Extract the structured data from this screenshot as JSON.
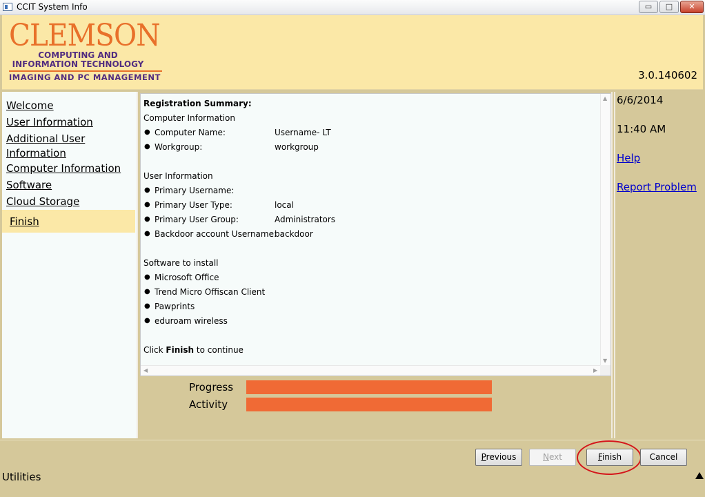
{
  "window": {
    "title": "CCIT System Info",
    "icon": "app-window-icon",
    "controls": {
      "minimize": "▭",
      "maximize": "□",
      "close": "✕"
    }
  },
  "header": {
    "logo": {
      "brand": "CLEMSON",
      "line1": "COMPUTING AND",
      "line2": "INFORMATION TECHNOLOGY",
      "line3": "IMAGING AND PC MANAGEMENT"
    },
    "version": "3.0.140602"
  },
  "nav": {
    "items": [
      {
        "label": "Welcome"
      },
      {
        "label": "User Information"
      },
      {
        "label": "Additional User"
      },
      {
        "label": "Information"
      },
      {
        "label": "Computer Information"
      },
      {
        "label": "Software"
      },
      {
        "label": "Cloud Storage"
      },
      {
        "label": "Finish",
        "selected": true
      }
    ]
  },
  "summary": {
    "heading": "Registration Summary:",
    "computer_section": "Computer Information",
    "computer_rows": [
      {
        "key": "Computer Name:",
        "value": "Username-  LT"
      },
      {
        "key": "Workgroup:",
        "value": "workgroup"
      }
    ],
    "user_section": "User Information",
    "user_rows": [
      {
        "key": "Primary Username:",
        "value": ""
      },
      {
        "key": "Primary User Type:",
        "value": "local"
      },
      {
        "key": "Primary User Group:",
        "value": "Administrators"
      },
      {
        "key": "Backdoor account Username:",
        "value": "backdoor"
      }
    ],
    "software_section": "Software to install",
    "software_items": [
      "Microsoft Office",
      "Trend Micro Offiscan Client",
      "Pawprints",
      "eduroam wireless"
    ],
    "footer_prefix": "Click ",
    "footer_bold": "Finish",
    "footer_suffix": " to continue",
    "bullet": "●"
  },
  "progress": {
    "progress_label": "Progress",
    "activity_label": "Activity",
    "bar_color": "#f06a35"
  },
  "side": {
    "date": "6/6/2014",
    "time": "11:40 AM",
    "help_link": "Help",
    "report_link": "Report Problem"
  },
  "buttons": {
    "previous_u": "P",
    "previous_rest": "revious",
    "next_u": "N",
    "next_rest": "ext",
    "finish_u": "F",
    "finish_rest": "inish",
    "cancel": "Cancel"
  },
  "footer": {
    "utilities": "Utilities",
    "expand_icon": "triangle-up-icon"
  },
  "colors": {
    "header_bg": "#fbe8a7",
    "panel_bg": "#d5c89a",
    "brand_orange": "#e8702a",
    "brand_purple": "#522d80",
    "link": "#0000cc",
    "annotation_ring": "#d4161b"
  }
}
